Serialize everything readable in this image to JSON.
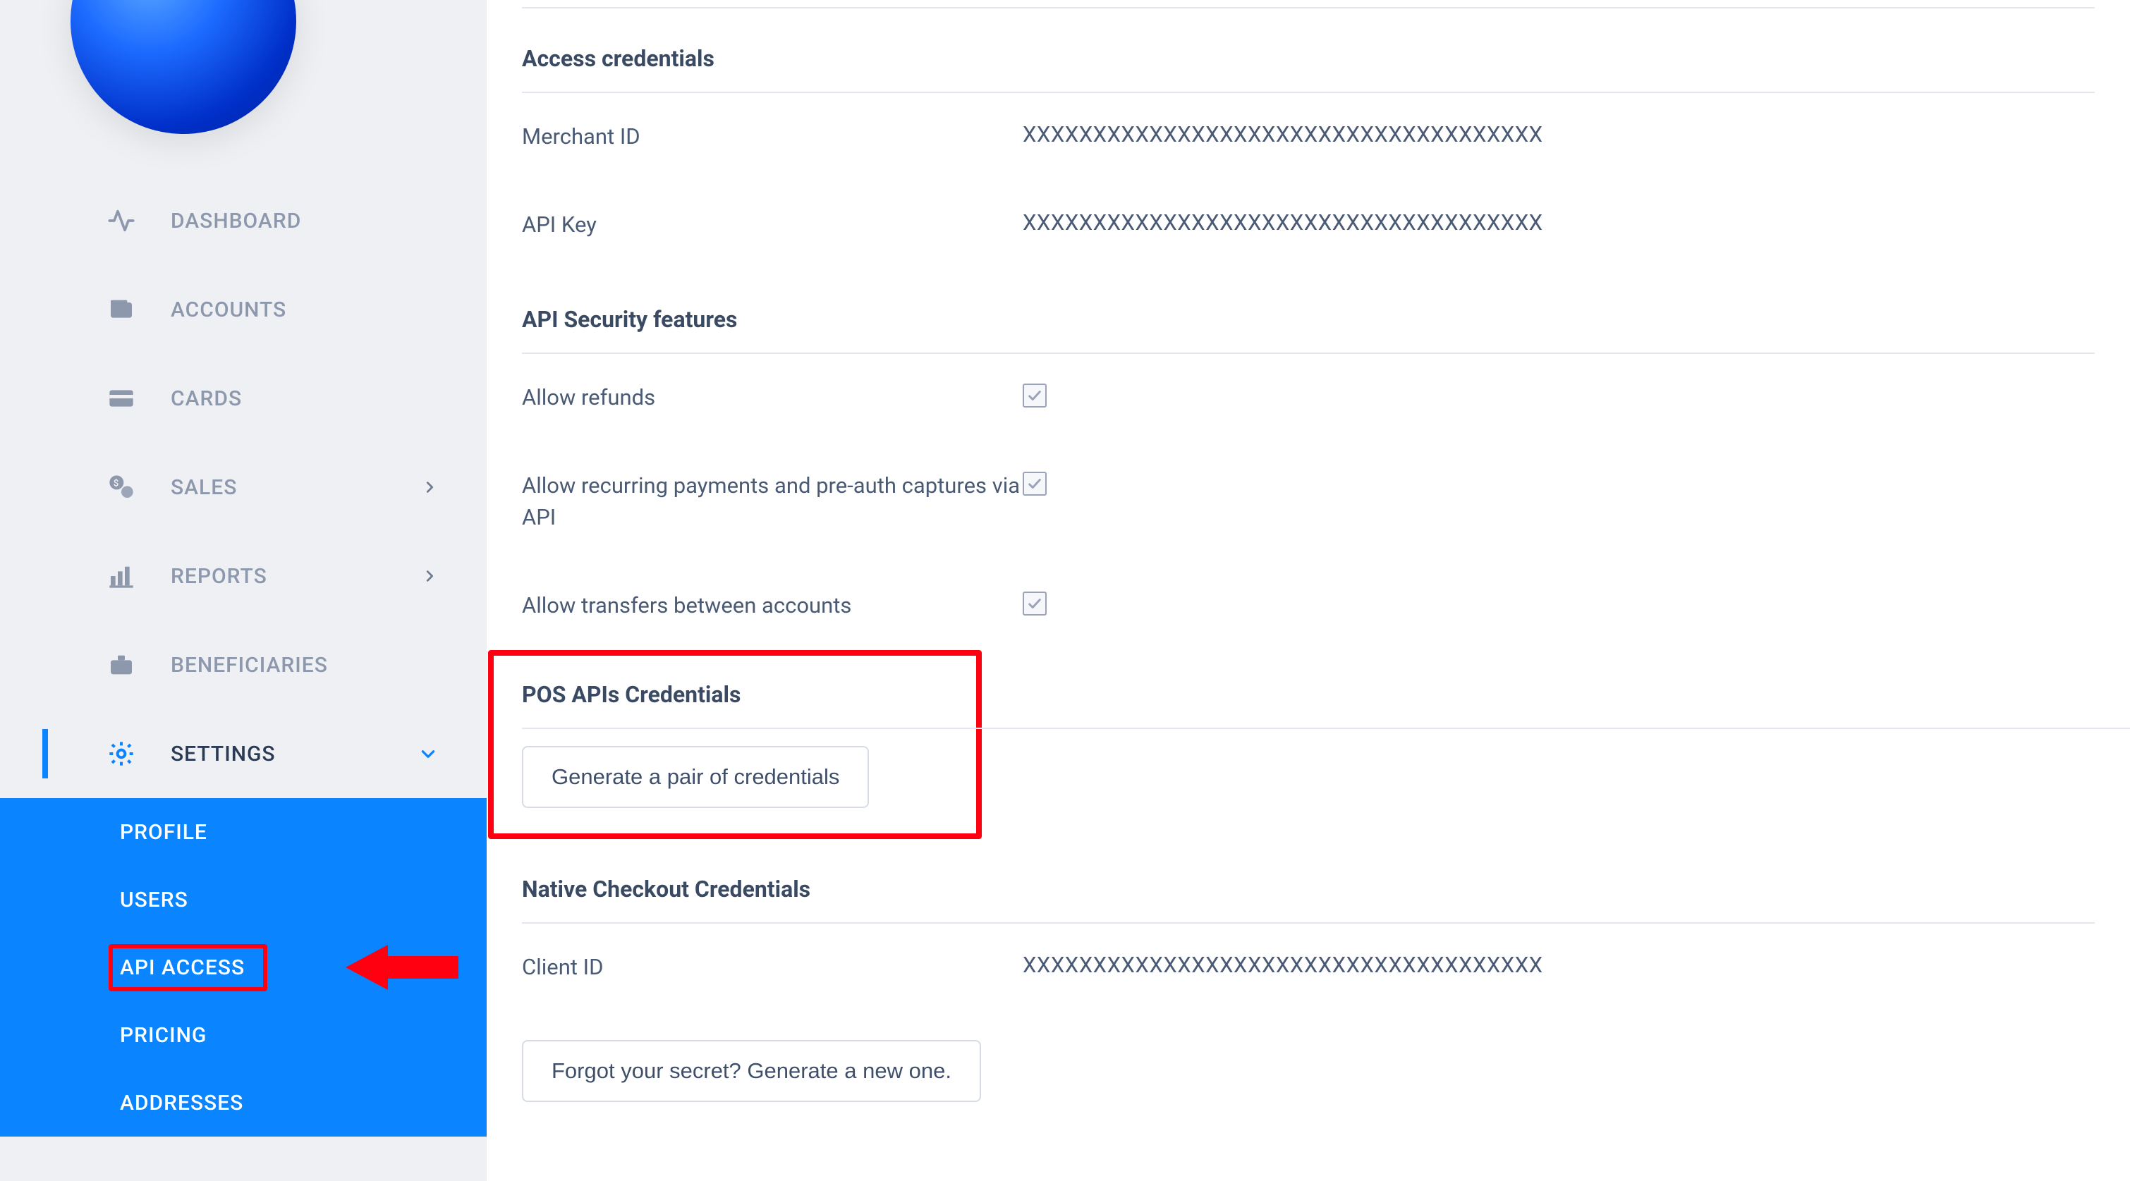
{
  "sidebar": {
    "items": [
      {
        "icon": "activity",
        "label": "DASHBOARD",
        "expandable": false
      },
      {
        "icon": "wallet",
        "label": "ACCOUNTS",
        "expandable": false
      },
      {
        "icon": "card",
        "label": "CARDS",
        "expandable": false
      },
      {
        "icon": "sales",
        "label": "SALES",
        "expandable": true
      },
      {
        "icon": "bar-chart",
        "label": "REPORTS",
        "expandable": true
      },
      {
        "icon": "briefcase",
        "label": "BENEFICIARIES",
        "expandable": false
      },
      {
        "icon": "gear",
        "label": "SETTINGS",
        "expandable": true,
        "active": true,
        "open": true
      }
    ],
    "subitems": [
      {
        "label": "PROFILE"
      },
      {
        "label": "USERS"
      },
      {
        "label": "API ACCESS",
        "highlighted": true
      },
      {
        "label": "PRICING"
      },
      {
        "label": "ADDRESSES"
      }
    ]
  },
  "main": {
    "access_credentials": {
      "title": "Access credentials",
      "merchant_id_label": "Merchant ID",
      "merchant_id_value": "XXXXXXXXXXXXXXXXXXXXXXXXXXXXXXXXXXXXX",
      "api_key_label": "API Key",
      "api_key_value": "XXXXXXXXXXXXXXXXXXXXXXXXXXXXXXXXXXXXX"
    },
    "api_security": {
      "title": "API Security features",
      "allow_refunds_label": "Allow refunds",
      "allow_refunds_checked": true,
      "allow_recurring_label": "Allow recurring payments and pre-auth captures via API",
      "allow_recurring_checked": true,
      "allow_transfers_label": "Allow transfers between accounts",
      "allow_transfers_checked": true
    },
    "pos": {
      "title": "POS APIs Credentials",
      "generate_btn": "Generate a pair of credentials"
    },
    "native_checkout": {
      "title": "Native Checkout Credentials",
      "client_id_label": "Client ID",
      "client_id_value": "XXXXXXXXXXXXXXXXXXXXXXXXXXXXXXXXXXXXX",
      "forgot_btn": "Forgot your secret? Generate a new one."
    }
  }
}
